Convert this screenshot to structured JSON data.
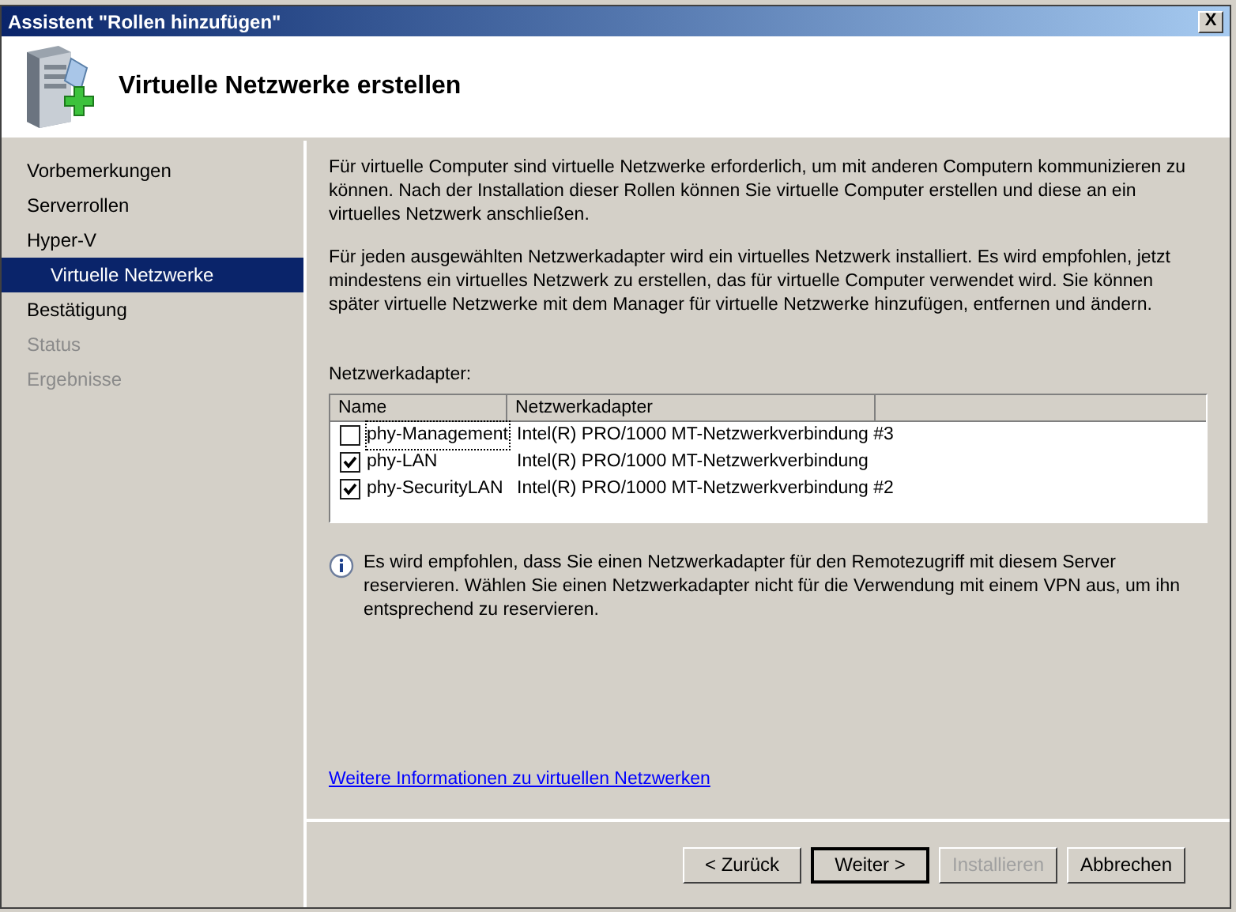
{
  "window": {
    "title": "Assistent \"Rollen hinzufügen\"",
    "close_label": "X"
  },
  "header": {
    "title": "Virtuelle Netzwerke erstellen"
  },
  "sidebar": {
    "items": [
      {
        "label": "Vorbemerkungen",
        "selected": false,
        "disabled": false
      },
      {
        "label": "Serverrollen",
        "selected": false,
        "disabled": false
      },
      {
        "label": "Hyper-V",
        "selected": false,
        "disabled": false,
        "children": [
          {
            "label": "Virtuelle Netzwerke",
            "selected": true
          }
        ]
      },
      {
        "label": "Bestätigung",
        "selected": false,
        "disabled": false
      },
      {
        "label": "Status",
        "selected": false,
        "disabled": true
      },
      {
        "label": "Ergebnisse",
        "selected": false,
        "disabled": true
      }
    ]
  },
  "intro": [
    "Für virtuelle Computer sind virtuelle Netzwerke erforderlich, um mit anderen Computern kommunizieren zu können. Nach der Installation dieser Rollen können Sie virtuelle Computer erstellen und diese an ein virtuelles Netzwerk anschließen.",
    "Für jeden ausgewählten Netzwerkadapter wird ein virtuelles Netzwerk installiert. Es wird empfohlen, jetzt mindestens ein virtuelles Netzwerk zu erstellen, das für virtuelle Computer verwendet wird. Sie können später virtuelle Netzwerke mit dem Manager für virtuelle Netzwerke hinzufügen, entfernen und ändern."
  ],
  "table": {
    "label": "Netzwerkadapter:",
    "columns": [
      "Name",
      "Netzwerkadapter"
    ],
    "rows": [
      {
        "name": "phy-Management",
        "adapter": "Intel(R) PRO/1000 MT-Netzwerkverbindung #3",
        "checked": false,
        "focused": true
      },
      {
        "name": "phy-LAN",
        "adapter": "Intel(R) PRO/1000 MT-Netzwerkverbindung",
        "checked": true,
        "focused": false
      },
      {
        "name": "phy-SecurityLAN",
        "adapter": "Intel(R) PRO/1000 MT-Netzwerkverbindung #2",
        "checked": true,
        "focused": false
      }
    ]
  },
  "info": "Es wird empfohlen, dass Sie einen Netzwerkadapter für den Remotezugriff mit diesem Server reservieren. Wählen Sie einen Netzwerkadapter nicht für die Verwendung mit einem VPN aus, um ihn entsprechend zu reservieren.",
  "link": "Weitere Informationen zu virtuellen Netzwerken",
  "buttons": [
    {
      "label": "< Zurück",
      "disabled": false,
      "default": false
    },
    {
      "label": "Weiter >",
      "disabled": false,
      "default": true
    },
    {
      "label": "Installieren",
      "disabled": true,
      "default": false
    },
    {
      "label": "Abbrechen",
      "disabled": false,
      "default": false
    }
  ]
}
